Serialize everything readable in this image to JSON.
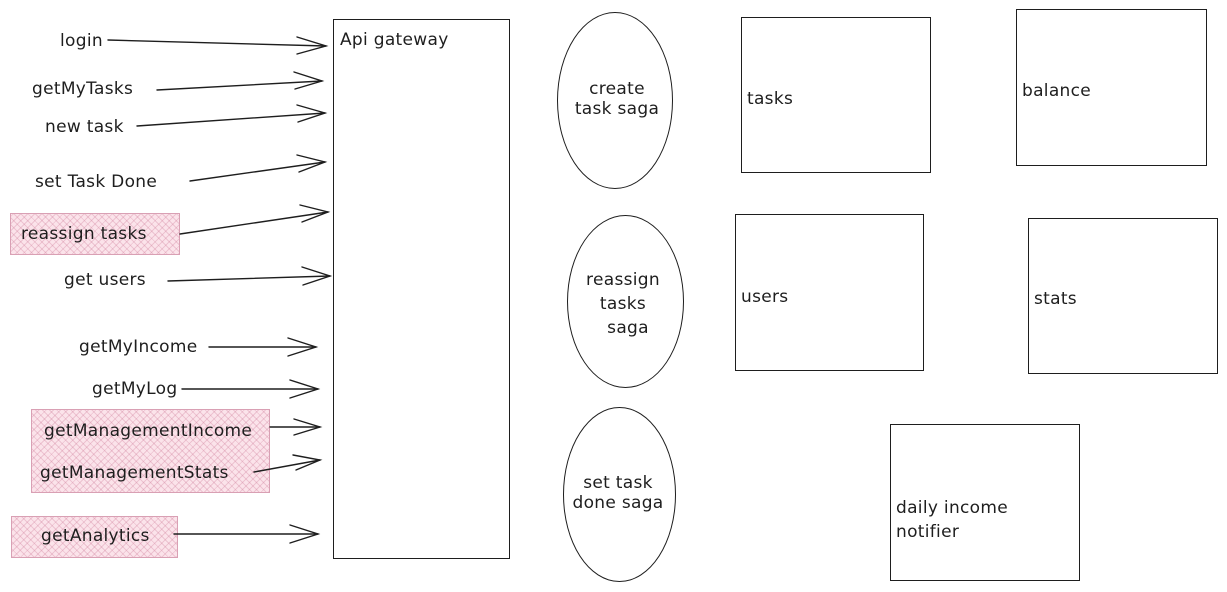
{
  "requests": [
    "login",
    "getMyTasks",
    "new task",
    "set Task Done",
    "reassign tasks",
    "get users",
    "getMyIncome",
    "getMyLog",
    "getManagementIncome",
    "getManagementStats",
    "getAnalytics"
  ],
  "gateway": {
    "label": "Api gateway"
  },
  "sagas": [
    [
      "create",
      "task saga"
    ],
    [
      "reassign",
      "tasks",
      "saga"
    ],
    [
      "set task",
      "done saga"
    ]
  ],
  "services": {
    "tasks": "tasks",
    "balance": "balance",
    "users": "users",
    "stats": "stats",
    "notifier": [
      "daily income",
      "notifier"
    ]
  },
  "colors": {
    "stroke": "#1e1e1e",
    "highlight_fill": "#fbe3ea",
    "highlight_border": "#d9a0b4"
  }
}
